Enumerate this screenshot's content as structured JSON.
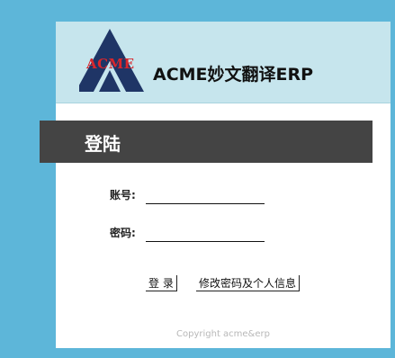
{
  "header": {
    "logo_text": "ACME",
    "app_title": "ACME妙文翻译ERP"
  },
  "banner": {
    "title": "登陆"
  },
  "form": {
    "account_label": "账号:",
    "account_value": "",
    "password_label": "密码:",
    "password_value": ""
  },
  "buttons": {
    "login": "登 录",
    "modify": "修改密码及个人信息"
  },
  "footer": {
    "copyright": "Copyright acme&erp"
  },
  "colors": {
    "page_background": "#5db6d9",
    "header_background": "#c6e5ed",
    "banner_background": "#444444",
    "logo_triangle": "#1f3566",
    "logo_text": "#d9262c"
  }
}
